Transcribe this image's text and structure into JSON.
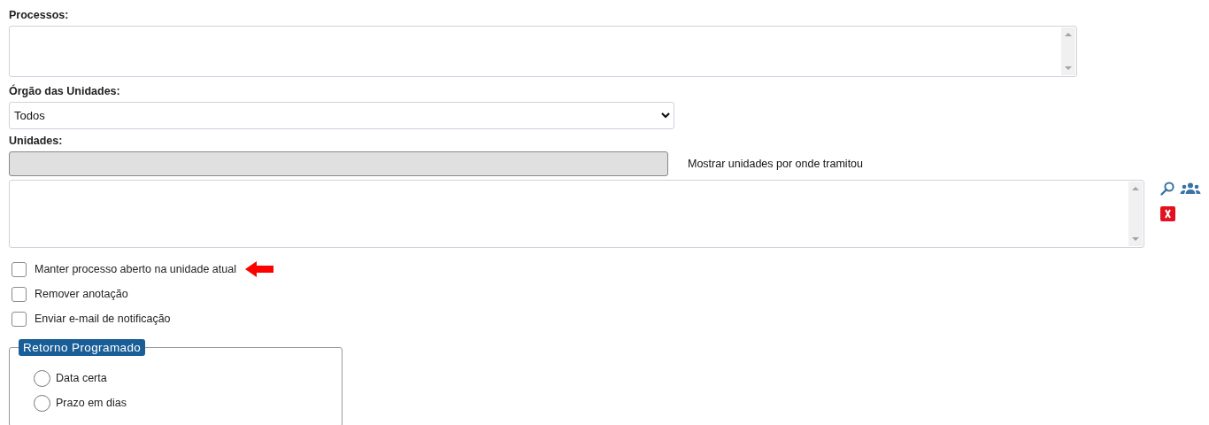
{
  "processos": {
    "label": "Processos:"
  },
  "orgao": {
    "label": "Órgão das Unidades:",
    "value": "Todos"
  },
  "unidades": {
    "label": "Unidades:",
    "disabled": true,
    "link": "Mostrar unidades por onde tramitou"
  },
  "options": [
    {
      "label": "Manter processo aberto na unidade atual",
      "checked": false,
      "pointed": true
    },
    {
      "label": "Remover anotação",
      "checked": false,
      "pointed": false
    },
    {
      "label": "Enviar e-mail de notificação",
      "checked": false,
      "pointed": false
    }
  ],
  "retorno": {
    "legend": "Retorno Programado",
    "options": [
      {
        "label": "Data certa",
        "selected": false
      },
      {
        "label": "Prazo em dias",
        "selected": false
      }
    ]
  }
}
